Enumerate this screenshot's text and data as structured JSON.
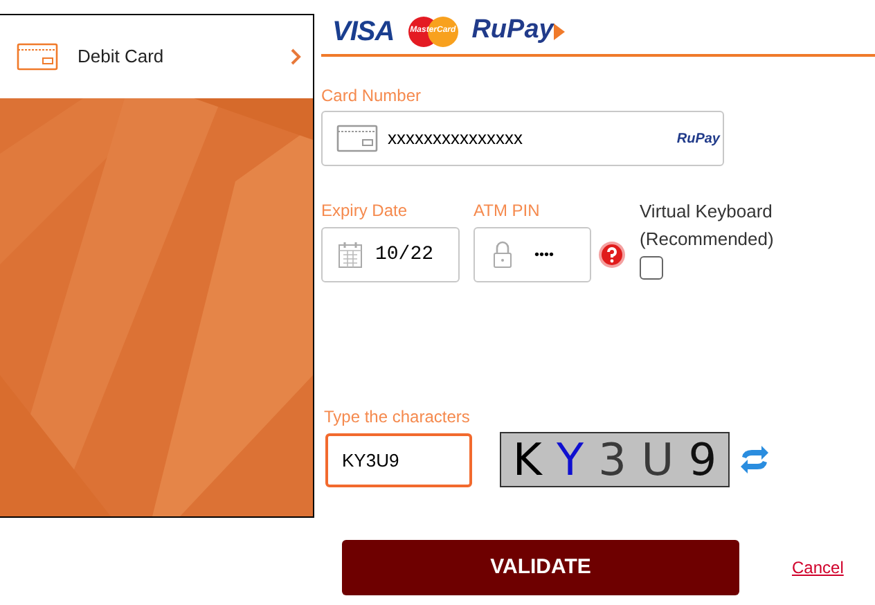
{
  "payment_method": {
    "label": "Debit Card",
    "selected": true
  },
  "card_brands": [
    "VISA",
    "MasterCard",
    "RuPay"
  ],
  "card_number": {
    "label": "Card Number",
    "value": "xxxxxxxxxxxxxxx",
    "brand": "RuPay"
  },
  "expiry_date": {
    "label": "Expiry Date",
    "value": "10/22"
  },
  "atm_pin": {
    "label": "ATM PIN",
    "value": "••••"
  },
  "virtual_keyboard": {
    "label": "Virtual Keyboard",
    "note": "(Recommended)",
    "checked": false
  },
  "captcha": {
    "label": "Type the characters",
    "value": "KY3U9",
    "chars": [
      {
        "text": "K",
        "color": "#000000"
      },
      {
        "text": "Y",
        "color": "#1010d0"
      },
      {
        "text": "3",
        "color": "#3a3a3a"
      },
      {
        "text": "U",
        "color": "#3a3a3a"
      },
      {
        "text": "9",
        "color": "#111111"
      }
    ]
  },
  "validate_button": "VALIDATE",
  "cancel_link": "Cancel"
}
